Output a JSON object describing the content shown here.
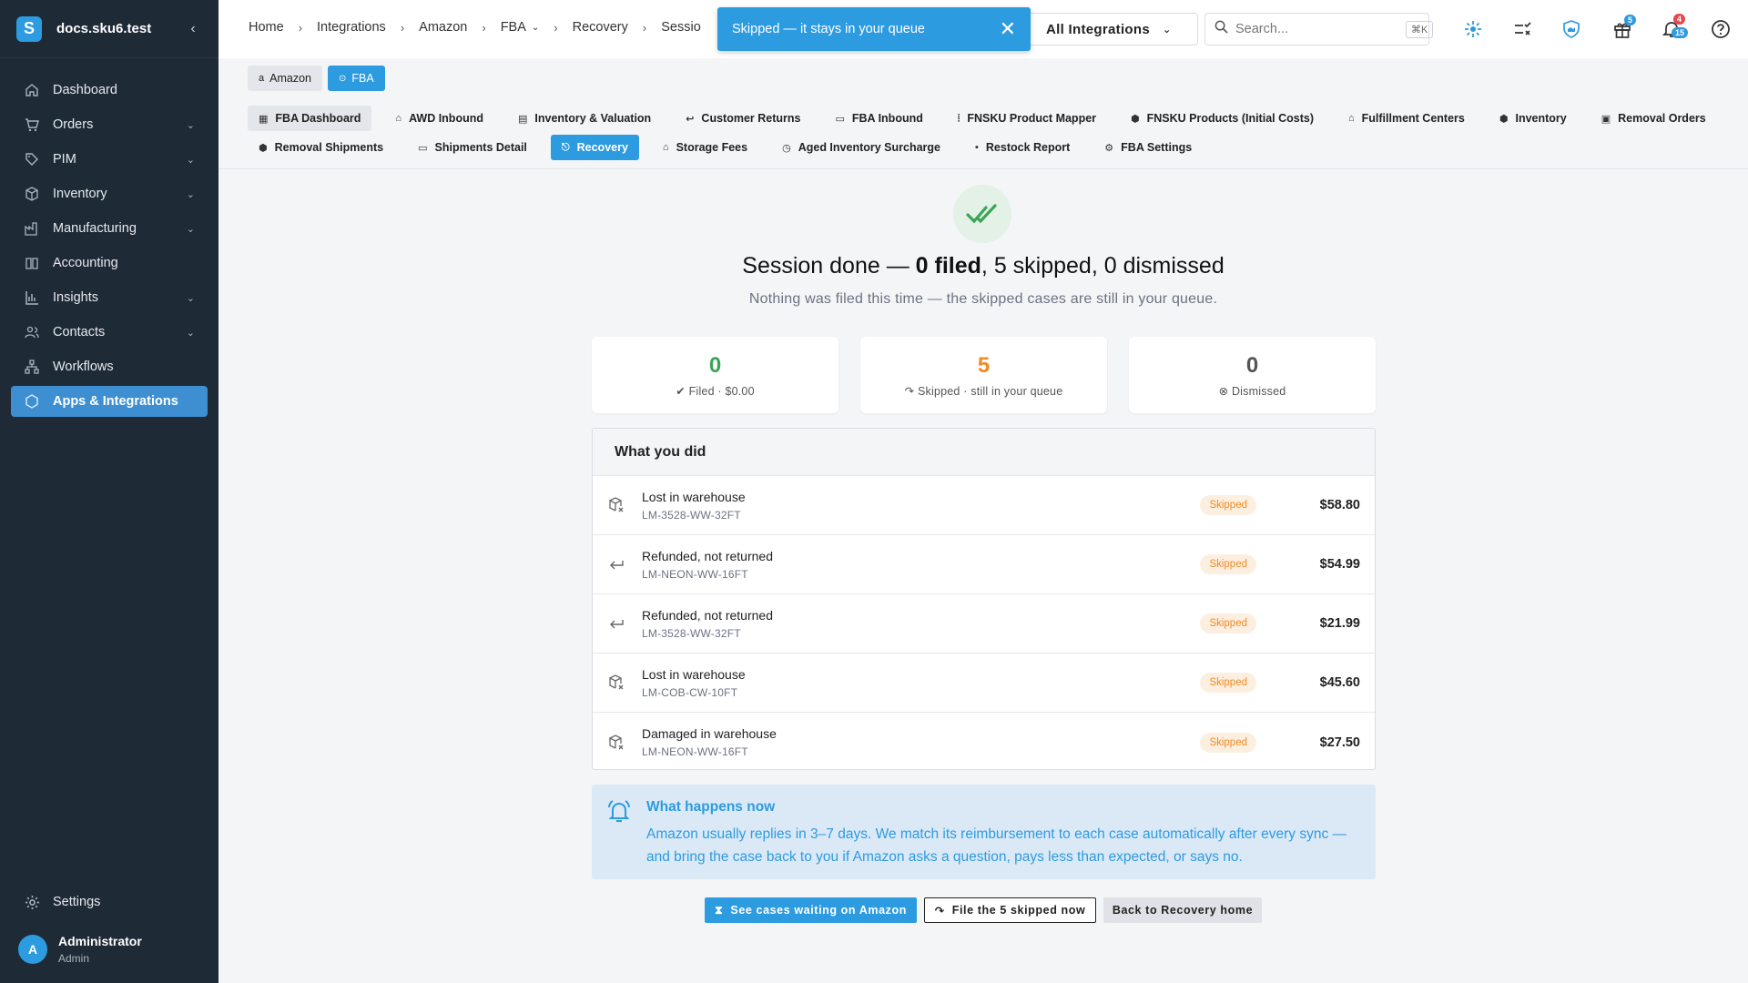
{
  "app": {
    "site": "docs.sku6.test",
    "logo_letter": "S"
  },
  "sidebar": {
    "items": [
      {
        "label": "Dashboard",
        "icon": "home-icon",
        "expandable": false
      },
      {
        "label": "Orders",
        "icon": "cart-icon",
        "expandable": true
      },
      {
        "label": "PIM",
        "icon": "tag-icon",
        "expandable": true
      },
      {
        "label": "Inventory",
        "icon": "box-icon",
        "expandable": true
      },
      {
        "label": "Manufacturing",
        "icon": "factory-icon",
        "expandable": true
      },
      {
        "label": "Accounting",
        "icon": "book-icon",
        "expandable": false
      },
      {
        "label": "Insights",
        "icon": "bar-chart-icon",
        "expandable": true
      },
      {
        "label": "Contacts",
        "icon": "contacts-icon",
        "expandable": true
      },
      {
        "label": "Workflows",
        "icon": "workflow-icon",
        "expandable": false
      },
      {
        "label": "Apps & Integrations",
        "icon": "integrations-icon",
        "expandable": false,
        "active": true
      }
    ],
    "settings_label": "Settings",
    "user": {
      "initial": "A",
      "name": "Administrator",
      "role": "Admin"
    }
  },
  "breadcrumb": [
    "Home",
    "Integrations",
    "Amazon",
    "FBA",
    "Recovery",
    "Sessio"
  ],
  "integration_select": "All Integrations",
  "search": {
    "placeholder": "Search...",
    "shortcut": "⌘K"
  },
  "badges": {
    "gift": "5",
    "bell_red": "4",
    "bell_blue": "15"
  },
  "toast": {
    "message": "Skipped — it stays in your queue"
  },
  "chips": [
    {
      "label": "Amazon",
      "icon": "amazon-icon"
    },
    {
      "label": "FBA",
      "icon": "fba-icon"
    }
  ],
  "tabs": [
    {
      "label": "FBA Dashboard",
      "style": "gray"
    },
    {
      "label": "AWD Inbound"
    },
    {
      "label": "Inventory & Valuation"
    },
    {
      "label": "Customer Returns"
    },
    {
      "label": "FBA Inbound"
    },
    {
      "label": "FNSKU Product Mapper"
    },
    {
      "label": "FNSKU Products (Initial Costs)"
    },
    {
      "label": "Fulfillment Centers"
    },
    {
      "label": "Inventory"
    },
    {
      "label": "Removal Orders"
    },
    {
      "label": "Removal Shipments"
    },
    {
      "label": "Shipments Detail"
    },
    {
      "label": "Recovery",
      "style": "active"
    },
    {
      "label": "Storage Fees"
    },
    {
      "label": "Aged Inventory Surcharge"
    },
    {
      "label": "Restock Report"
    },
    {
      "label": "FBA Settings"
    }
  ],
  "summary": {
    "headline_pre": "Session done — ",
    "headline_bold": "0 filed",
    "headline_post": ", 5 skipped, 0 dismissed",
    "subline": "Nothing was filed this time — the skipped cases are still in your queue."
  },
  "stats": [
    {
      "value": "0",
      "caption": "Filed · $0.00",
      "color": "#3aa655"
    },
    {
      "value": "5",
      "caption": "Skipped · still in your queue",
      "color": "#f08a24"
    },
    {
      "value": "0",
      "caption": "Dismissed",
      "color": "#555555"
    }
  ],
  "activity": {
    "title": "What you did",
    "rows": [
      {
        "title": "Lost in warehouse",
        "sku": "LM-3528-WW-32FT",
        "status": "Skipped",
        "amount": "$58.80",
        "icon": "lost-box-icon"
      },
      {
        "title": "Refunded, not returned",
        "sku": "LM-NEON-WW-16FT",
        "status": "Skipped",
        "amount": "$54.99",
        "icon": "return-arrow-icon"
      },
      {
        "title": "Refunded, not returned",
        "sku": "LM-3528-WW-32FT",
        "status": "Skipped",
        "amount": "$21.99",
        "icon": "return-arrow-icon"
      },
      {
        "title": "Lost in warehouse",
        "sku": "LM-COB-CW-10FT",
        "status": "Skipped",
        "amount": "$45.60",
        "icon": "lost-box-icon"
      },
      {
        "title": "Damaged in warehouse",
        "sku": "LM-NEON-WW-16FT",
        "status": "Skipped",
        "amount": "$27.50",
        "icon": "damaged-box-icon"
      }
    ]
  },
  "info": {
    "title": "What happens now",
    "body": "Amazon usually replies in 3–7 days. We match its reimbursement to each case automatically after every sync — and bring the case back to you if Amazon asks a question, pays less than expected, or says no."
  },
  "buttons": {
    "waiting": "See cases waiting on Amazon",
    "file_skipped": "File the 5 skipped now",
    "back": "Back to Recovery home"
  },
  "colors": {
    "accent": "#2d9be0",
    "sidebar": "#1f2a37",
    "success": "#3aa655",
    "warning": "#f08a24"
  }
}
